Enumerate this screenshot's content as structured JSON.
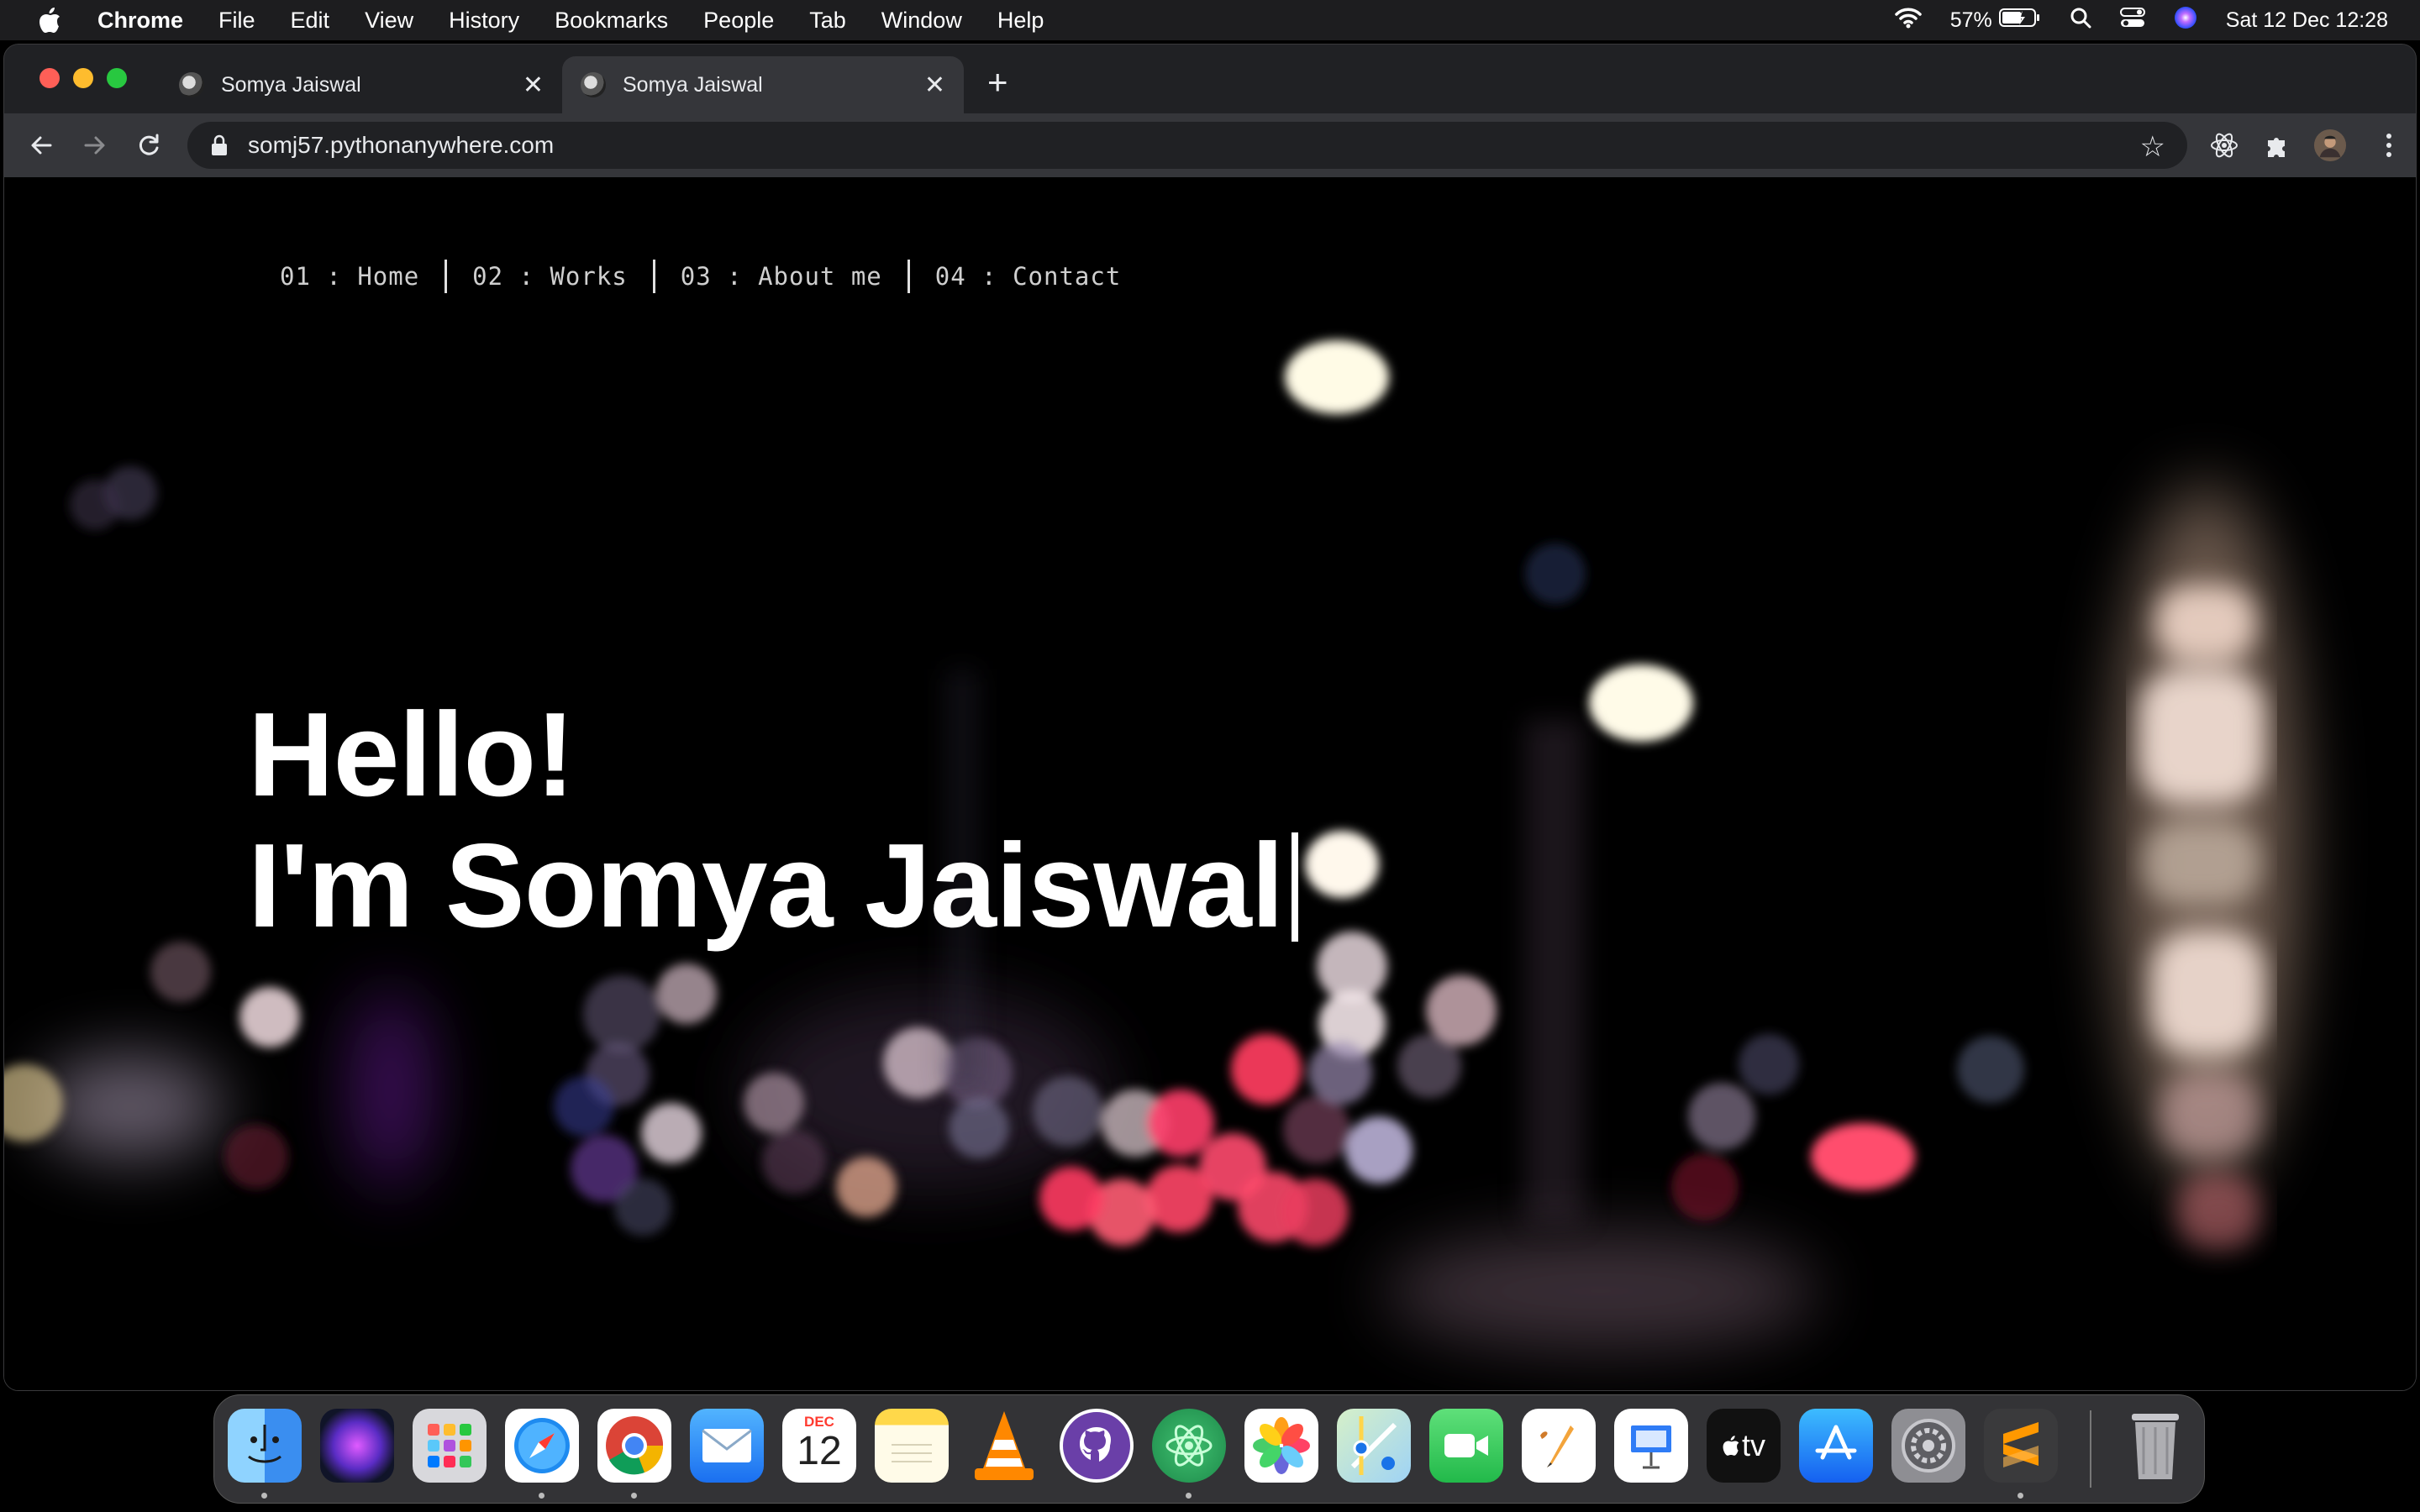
{
  "menubar": {
    "app_name": "Chrome",
    "menus": [
      "File",
      "Edit",
      "View",
      "History",
      "Bookmarks",
      "People",
      "Tab",
      "Window",
      "Help"
    ],
    "battery": "57%",
    "datetime": "Sat 12 Dec  12:28"
  },
  "browser": {
    "tabs": [
      {
        "title": "Somya Jaiswal",
        "active": false
      },
      {
        "title": "Somya Jaiswal",
        "active": true
      }
    ],
    "url": "somj57.pythonanywhere.com"
  },
  "site": {
    "nav": [
      {
        "num": "01",
        "label": "Home"
      },
      {
        "num": "02",
        "label": "Works"
      },
      {
        "num": "03",
        "label": "About me"
      },
      {
        "num": "04",
        "label": "Contact"
      }
    ],
    "hero_line1": "Hello!",
    "hero_line2": "I'm Somya Jaiswal"
  },
  "dock": {
    "calendar_month": "DEC",
    "calendar_day": "12",
    "tv_label": "tv",
    "apps": [
      "finder-icon",
      "siri-icon",
      "launchpad-icon",
      "safari-icon",
      "chrome-icon",
      "mail-icon",
      "calendar-icon",
      "notes-icon",
      "vlc-icon",
      "github-desktop-icon",
      "atom-icon",
      "photos-icon",
      "maps-icon",
      "facetime-icon",
      "pages-icon",
      "keynote-icon",
      "apple-tv-icon",
      "app-store-icon",
      "system-preferences-icon",
      "sublime-text-icon",
      "trash-icon"
    ]
  },
  "colors": {
    "menubar": "#1d1d1f",
    "tab_active": "#35363a",
    "tabstrip": "#202124",
    "page_bg": "#000000",
    "hero_text": "#ffffff"
  }
}
